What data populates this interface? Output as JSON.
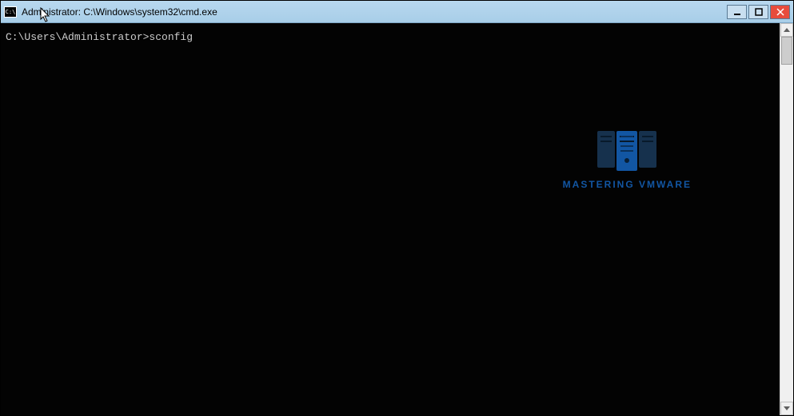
{
  "window": {
    "title": "Administrator: C:\\Windows\\system32\\cmd.exe"
  },
  "console": {
    "line1": "C:\\Users\\Administrator>sconfig"
  },
  "watermark": {
    "text": "MASTERING VMWARE"
  }
}
